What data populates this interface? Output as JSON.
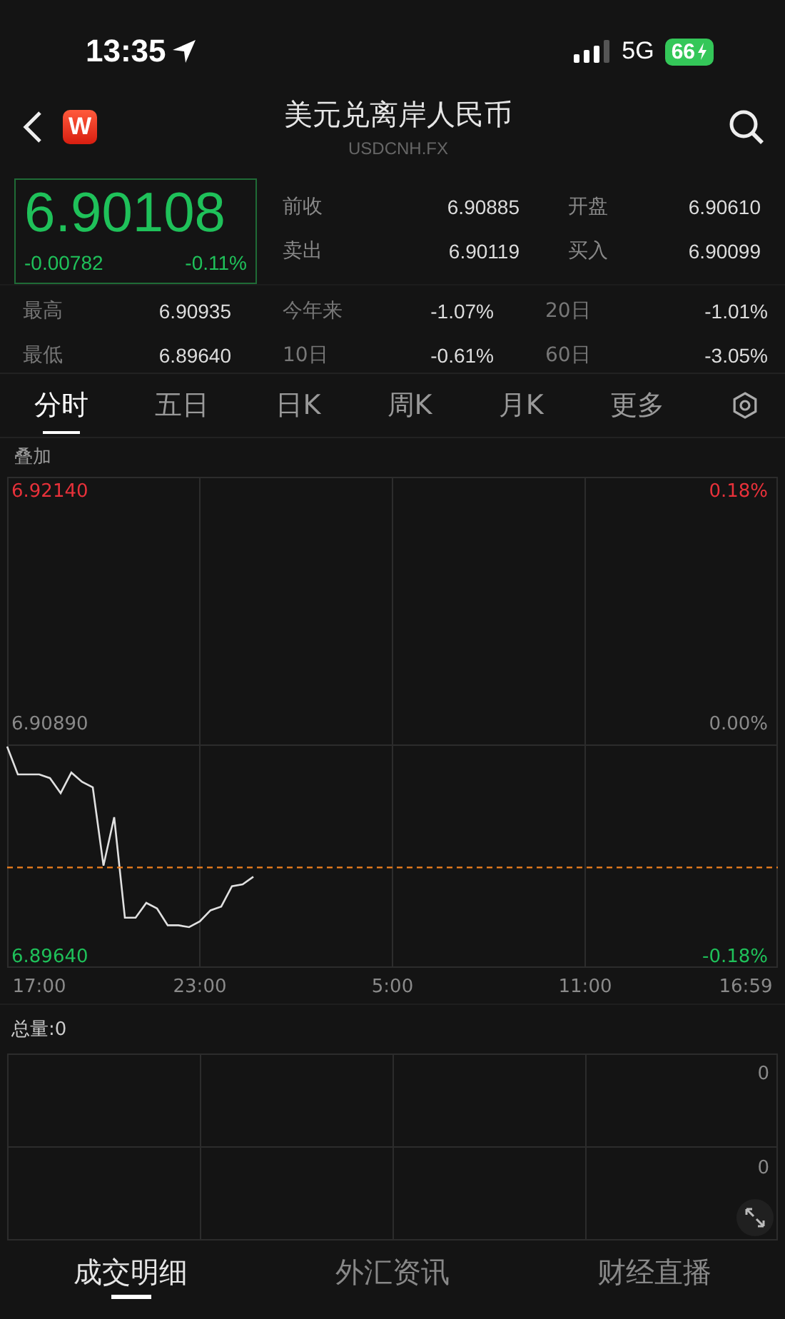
{
  "status_bar": {
    "time": "13:35",
    "network": "5G",
    "battery": "66"
  },
  "header": {
    "logo": "W",
    "title": "美元兑离岸人民币",
    "symbol": "USDCNH.FX"
  },
  "quote": {
    "price": "6.90108",
    "change": "-0.00782",
    "change_pct": "-0.11%"
  },
  "top_stats": [
    {
      "label": "前收",
      "value": "6.90885"
    },
    {
      "label": "开盘",
      "value": "6.90610"
    },
    {
      "label": "卖出",
      "value": "6.90119"
    },
    {
      "label": "买入",
      "value": "6.90099"
    }
  ],
  "range_stats": [
    {
      "label": "最高",
      "value": "6.90935"
    },
    {
      "label": "今年来",
      "value": "-1.07%"
    },
    {
      "label": "20日",
      "value": "-1.01%"
    },
    {
      "label": "最低",
      "value": "6.89640"
    },
    {
      "label": "10日",
      "value": "-0.61%"
    },
    {
      "label": "60日",
      "value": "-3.05%"
    }
  ],
  "chart_tabs": [
    {
      "label": "分时",
      "selected": true
    },
    {
      "label": "五日",
      "selected": false
    },
    {
      "label": "日K",
      "selected": false
    },
    {
      "label": "周K",
      "selected": false
    },
    {
      "label": "月K",
      "selected": false
    },
    {
      "label": "更多",
      "selected": false
    }
  ],
  "overlay_label": "叠加",
  "price_chart": {
    "right_labels": [
      "0.18%",
      "0.00%",
      "-0.18%"
    ],
    "chart_data": {
      "type": "line",
      "grid": true,
      "ylim": [
        6.89575,
        6.92205
      ],
      "yticks": [
        {
          "value": 6.9214,
          "label": "6.92140"
        },
        {
          "value": 6.9089,
          "label": "6.90890"
        },
        {
          "value": 6.8964,
          "label": "6.89640"
        }
      ],
      "categories": [
        null,
        null,
        null,
        "17:00",
        null,
        null,
        null,
        null,
        null,
        null,
        null,
        null,
        null,
        null,
        null,
        null,
        null,
        null,
        "23:00",
        null,
        null,
        null,
        null,
        null,
        null,
        null,
        null,
        null,
        null,
        null,
        null,
        null,
        null,
        null,
        null,
        null,
        "5:00",
        null,
        null,
        null,
        null,
        null,
        null,
        null,
        null,
        null,
        null,
        null,
        null,
        null,
        null,
        null,
        null,
        null,
        "11:00",
        null,
        null,
        null,
        null,
        null,
        null,
        null,
        null,
        null,
        null,
        null,
        null,
        null,
        null,
        "16:59",
        null,
        null,
        null
      ],
      "series": [
        {
          "color": "#e0e0e0",
          "values": [
            6.9076,
            6.9061,
            6.9061,
            6.9061,
            6.9059,
            6.9051,
            6.9062,
            6.9057,
            6.9054,
            6.9012,
            6.9038,
            6.8984,
            6.8984,
            6.8992,
            6.8989,
            6.898,
            6.898,
            6.8979,
            6.8982,
            6.8988,
            6.899,
            6.9001,
            6.9002,
            6.9006,
            null,
            null,
            null,
            null,
            null,
            null,
            null,
            null,
            null,
            null,
            null,
            null,
            null,
            null,
            null,
            null,
            null,
            null,
            null,
            null,
            null,
            null,
            null,
            null,
            null,
            null,
            null,
            null,
            null,
            null,
            null,
            null,
            null,
            null,
            null,
            null,
            null,
            null,
            null,
            null,
            null,
            null,
            null,
            null,
            null,
            null,
            null,
            null,
            null
          ]
        },
        {
          "color": "#f0801e",
          "line_style": "dashed",
          "values": [
            6.9011,
            6.9011,
            6.9011,
            6.9011,
            6.9011,
            6.9011,
            6.9011,
            6.9011,
            6.9011,
            6.9011,
            6.9011,
            6.9011,
            6.9011,
            6.9011,
            6.9011,
            6.9011,
            6.9011,
            6.9011,
            6.9011,
            6.9011,
            6.9011,
            6.9011,
            6.9011,
            6.9011,
            6.9011,
            6.9011,
            6.9011,
            6.9011,
            6.9011,
            6.9011,
            6.9011,
            6.9011,
            6.9011,
            6.9011,
            6.9011,
            6.9011,
            6.9011,
            6.9011,
            6.9011,
            6.9011,
            6.9011,
            6.9011,
            6.9011,
            6.9011,
            6.9011,
            6.9011,
            6.9011,
            6.9011,
            6.9011,
            6.9011,
            6.9011,
            6.9011,
            6.9011,
            6.9011,
            6.9011,
            6.9011,
            6.9011,
            6.9011,
            6.9011,
            6.9011,
            6.9011,
            6.9011,
            6.9011,
            6.9011,
            6.9011,
            6.9011,
            6.9011,
            6.9011,
            6.9011,
            6.9011,
            6.9011,
            6.9011,
            6.9011
          ]
        }
      ]
    }
  },
  "volume": {
    "label": "总量:0",
    "axis_labels": [
      "0",
      "0"
    ]
  },
  "bottom_tabs": [
    {
      "label": "成交明细",
      "selected": true
    },
    {
      "label": "外汇资讯",
      "selected": false
    },
    {
      "label": "财经直播",
      "selected": false
    }
  ]
}
